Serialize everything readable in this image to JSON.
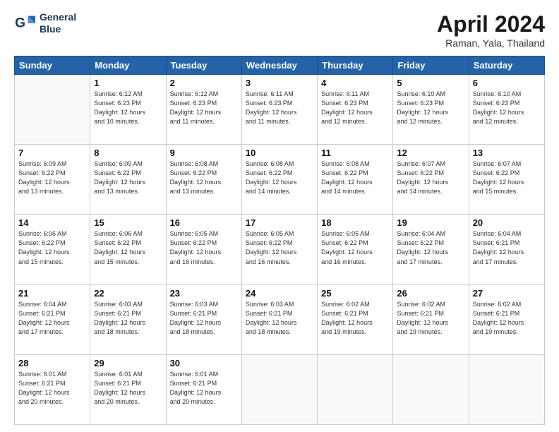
{
  "header": {
    "logo_line1": "General",
    "logo_line2": "Blue",
    "month_title": "April 2024",
    "location": "Raman, Yala, Thailand"
  },
  "weekdays": [
    "Sunday",
    "Monday",
    "Tuesday",
    "Wednesday",
    "Thursday",
    "Friday",
    "Saturday"
  ],
  "rows": [
    [
      {
        "num": "",
        "info": ""
      },
      {
        "num": "1",
        "info": "Sunrise: 6:12 AM\nSunset: 6:23 PM\nDaylight: 12 hours\nand 10 minutes."
      },
      {
        "num": "2",
        "info": "Sunrise: 6:12 AM\nSunset: 6:23 PM\nDaylight: 12 hours\nand 11 minutes."
      },
      {
        "num": "3",
        "info": "Sunrise: 6:11 AM\nSunset: 6:23 PM\nDaylight: 12 hours\nand 11 minutes."
      },
      {
        "num": "4",
        "info": "Sunrise: 6:11 AM\nSunset: 6:23 PM\nDaylight: 12 hours\nand 12 minutes."
      },
      {
        "num": "5",
        "info": "Sunrise: 6:10 AM\nSunset: 6:23 PM\nDaylight: 12 hours\nand 12 minutes."
      },
      {
        "num": "6",
        "info": "Sunrise: 6:10 AM\nSunset: 6:23 PM\nDaylight: 12 hours\nand 12 minutes."
      }
    ],
    [
      {
        "num": "7",
        "info": "Sunrise: 6:09 AM\nSunset: 6:22 PM\nDaylight: 12 hours\nand 13 minutes."
      },
      {
        "num": "8",
        "info": "Sunrise: 6:09 AM\nSunset: 6:22 PM\nDaylight: 12 hours\nand 13 minutes."
      },
      {
        "num": "9",
        "info": "Sunrise: 6:08 AM\nSunset: 6:22 PM\nDaylight: 12 hours\nand 13 minutes."
      },
      {
        "num": "10",
        "info": "Sunrise: 6:08 AM\nSunset: 6:22 PM\nDaylight: 12 hours\nand 14 minutes."
      },
      {
        "num": "11",
        "info": "Sunrise: 6:08 AM\nSunset: 6:22 PM\nDaylight: 12 hours\nand 14 minutes."
      },
      {
        "num": "12",
        "info": "Sunrise: 6:07 AM\nSunset: 6:22 PM\nDaylight: 12 hours\nand 14 minutes."
      },
      {
        "num": "13",
        "info": "Sunrise: 6:07 AM\nSunset: 6:22 PM\nDaylight: 12 hours\nand 15 minutes."
      }
    ],
    [
      {
        "num": "14",
        "info": "Sunrise: 6:06 AM\nSunset: 6:22 PM\nDaylight: 12 hours\nand 15 minutes."
      },
      {
        "num": "15",
        "info": "Sunrise: 6:06 AM\nSunset: 6:22 PM\nDaylight: 12 hours\nand 15 minutes."
      },
      {
        "num": "16",
        "info": "Sunrise: 6:05 AM\nSunset: 6:22 PM\nDaylight: 12 hours\nand 16 minutes."
      },
      {
        "num": "17",
        "info": "Sunrise: 6:05 AM\nSunset: 6:22 PM\nDaylight: 12 hours\nand 16 minutes."
      },
      {
        "num": "18",
        "info": "Sunrise: 6:05 AM\nSunset: 6:22 PM\nDaylight: 12 hours\nand 16 minutes."
      },
      {
        "num": "19",
        "info": "Sunrise: 6:04 AM\nSunset: 6:22 PM\nDaylight: 12 hours\nand 17 minutes."
      },
      {
        "num": "20",
        "info": "Sunrise: 6:04 AM\nSunset: 6:21 PM\nDaylight: 12 hours\nand 17 minutes."
      }
    ],
    [
      {
        "num": "21",
        "info": "Sunrise: 6:04 AM\nSunset: 6:21 PM\nDaylight: 12 hours\nand 17 minutes."
      },
      {
        "num": "22",
        "info": "Sunrise: 6:03 AM\nSunset: 6:21 PM\nDaylight: 12 hours\nand 18 minutes."
      },
      {
        "num": "23",
        "info": "Sunrise: 6:03 AM\nSunset: 6:21 PM\nDaylight: 12 hours\nand 18 minutes."
      },
      {
        "num": "24",
        "info": "Sunrise: 6:03 AM\nSunset: 6:21 PM\nDaylight: 12 hours\nand 18 minutes."
      },
      {
        "num": "25",
        "info": "Sunrise: 6:02 AM\nSunset: 6:21 PM\nDaylight: 12 hours\nand 19 minutes."
      },
      {
        "num": "26",
        "info": "Sunrise: 6:02 AM\nSunset: 6:21 PM\nDaylight: 12 hours\nand 19 minutes."
      },
      {
        "num": "27",
        "info": "Sunrise: 6:02 AM\nSunset: 6:21 PM\nDaylight: 12 hours\nand 19 minutes."
      }
    ],
    [
      {
        "num": "28",
        "info": "Sunrise: 6:01 AM\nSunset: 6:21 PM\nDaylight: 12 hours\nand 20 minutes."
      },
      {
        "num": "29",
        "info": "Sunrise: 6:01 AM\nSunset: 6:21 PM\nDaylight: 12 hours\nand 20 minutes."
      },
      {
        "num": "30",
        "info": "Sunrise: 6:01 AM\nSunset: 6:21 PM\nDaylight: 12 hours\nand 20 minutes."
      },
      {
        "num": "",
        "info": ""
      },
      {
        "num": "",
        "info": ""
      },
      {
        "num": "",
        "info": ""
      },
      {
        "num": "",
        "info": ""
      }
    ]
  ]
}
